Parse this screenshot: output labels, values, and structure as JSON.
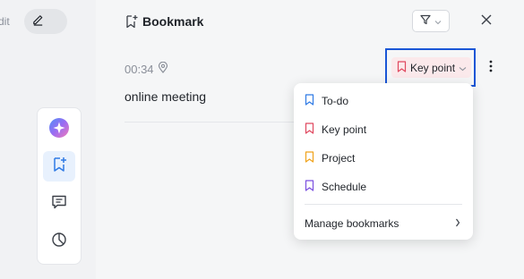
{
  "left": {
    "edit_text": "dit"
  },
  "header": {
    "title": "Bookmark"
  },
  "entry": {
    "time": "00:34",
    "note": "online meeting",
    "bookmark_type": "Key point"
  },
  "menu": {
    "items": [
      {
        "label": "To-do",
        "color": "#2f7ae5"
      },
      {
        "label": "Key point",
        "color": "#e0485f"
      },
      {
        "label": "Project",
        "color": "#f0a21a"
      },
      {
        "label": "Schedule",
        "color": "#7b4fe0"
      }
    ],
    "manage_label": "Manage bookmarks"
  },
  "colors": {
    "accent": "#1a56d6",
    "key_point": "#e0485f"
  }
}
